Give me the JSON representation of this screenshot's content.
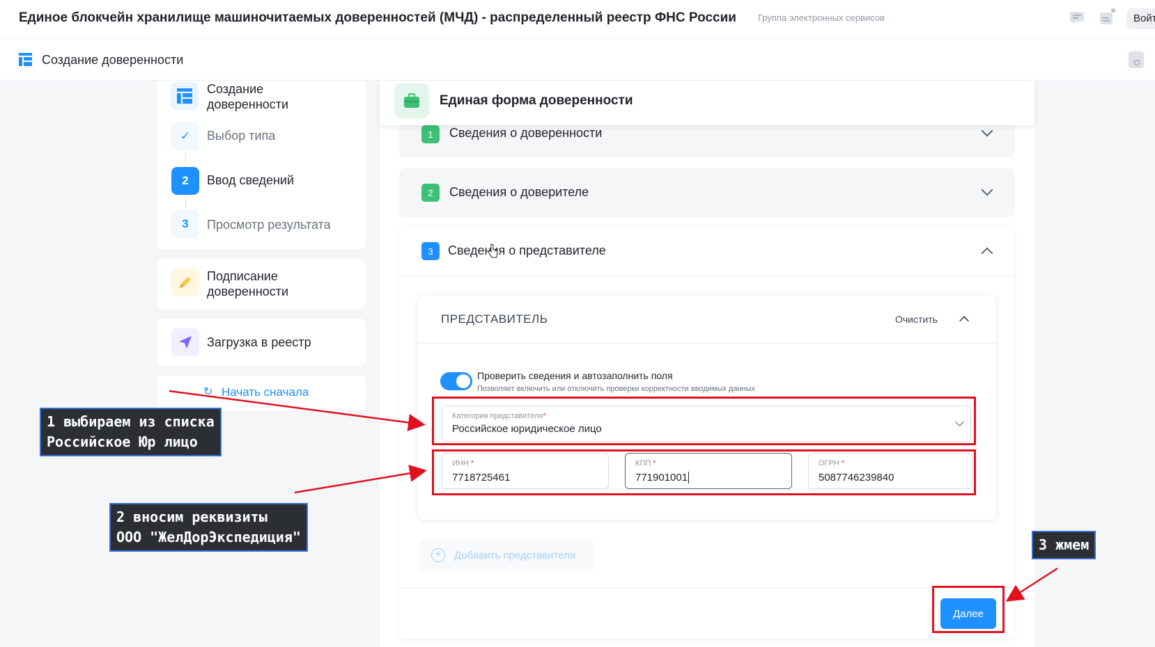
{
  "header": {
    "title": "Единое блокчейн хранилище машиночитаемых доверенностей (МЧД) - распределенный реестр ФНС России",
    "subtitle": "Группа электронных сервисов",
    "login_label": "Войти"
  },
  "subheader": {
    "title": "Создание доверенности"
  },
  "sidebar": {
    "create": {
      "label_line1": "Создание",
      "label_line2": "доверенности",
      "steps": [
        {
          "marker": "✓",
          "label": "Выбор типа"
        },
        {
          "marker": "2",
          "label": "Ввод сведений"
        },
        {
          "marker": "3",
          "label": "Просмотр результата"
        }
      ]
    },
    "sign": {
      "label_line1": "Подписание",
      "label_line2": "доверенности"
    },
    "upload": {
      "label": "Загрузка в реестр"
    },
    "restart": {
      "icon": "↻",
      "label": "Начать сначала"
    }
  },
  "form": {
    "title": "Единая форма доверенности",
    "sections": [
      {
        "number": "1",
        "label": "Сведения о доверенности",
        "expanded": false
      },
      {
        "number": "2",
        "label": "Сведения о доверителе",
        "expanded": false
      },
      {
        "number": "3",
        "label": "Сведения о представителе",
        "expanded": true
      }
    ],
    "representative": {
      "title": "ПРЕДСТАВИТЕЛЬ",
      "clear_label": "Очистить",
      "toggle": {
        "label": "Проверить сведения и автозаполнить поля",
        "description": "Позволяет включить или отключить проверки корректности вводимых данных",
        "on": true
      },
      "category": {
        "label": "Категория представителя",
        "required_mark": "*",
        "value": "Российское юридическое лицо"
      },
      "inn": {
        "label": "ИНН",
        "required_mark": "*",
        "value": "7718725461"
      },
      "kpp": {
        "label": "КПП",
        "required_mark": "*",
        "value": "771901001"
      },
      "ogrn": {
        "label": "ОГРН",
        "required_mark": "*",
        "value": "5087746239840"
      }
    },
    "add_representative_label": "Добавить представителя",
    "next_label": "Далее"
  },
  "annotations": {
    "callout1": {
      "line1": "1 выбираем из списка",
      "line2": "Российское Юр лицо"
    },
    "callout2": {
      "line1": "2 вносим реквизиты",
      "line2": "ООО \"ЖелДорЭкспедиция\""
    },
    "callout3": {
      "line1": "3 жмем"
    }
  },
  "colors": {
    "accent": "#1e90ff",
    "success": "#3dbf76",
    "annotation_red": "#e0101e",
    "callout_bg": "#2b2e33"
  }
}
